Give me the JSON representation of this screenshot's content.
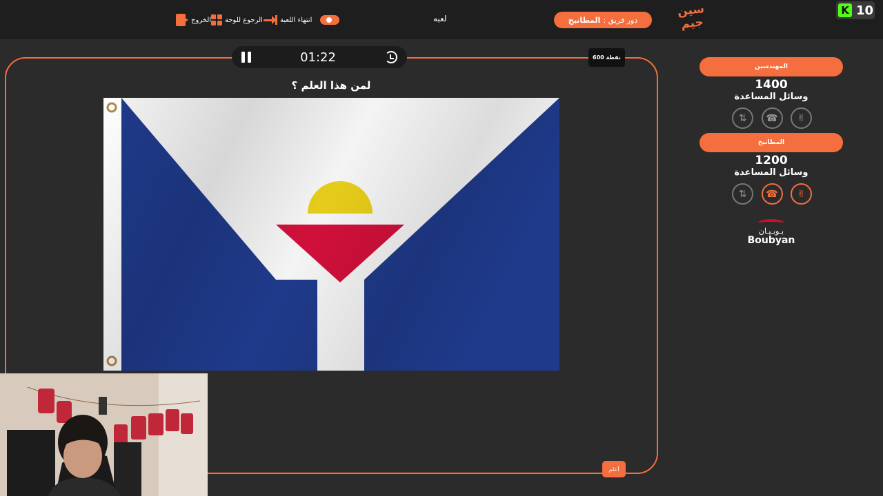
{
  "topbar": {
    "exit_label": "الخروج",
    "back_to_board_label": "الرجوع للوحة",
    "end_game_label": "انتهاء اللعبة",
    "game_label": "لعبه",
    "turn_prefix": "دور فريق :",
    "turn_team": "المطانيخ",
    "logo_text": "سين جيم",
    "kick_count": "10",
    "kick_letter": "K"
  },
  "board": {
    "timer": "01:22",
    "points": "600 نقطة",
    "question": "لمن هذا العلم ؟",
    "answer_button": "أعلم"
  },
  "teams": [
    {
      "name": "المهندسين",
      "score": "1400",
      "aids_label": "وسائل المساعدة",
      "aids": [
        "swap-icon",
        "phone-icon",
        "hand-icon"
      ],
      "active": [
        false,
        false,
        false
      ]
    },
    {
      "name": "المطانيخ",
      "score": "1200",
      "aids_label": "وسائل المساعدة",
      "aids": [
        "swap-icon",
        "phone-icon",
        "hand-icon"
      ],
      "active": [
        false,
        true,
        true
      ]
    }
  ],
  "sponsor": {
    "arabic": "بـوبـيـان",
    "english": "Boubyan"
  },
  "colors": {
    "accent": "#f46e3e",
    "background": "#2b2b2b",
    "topbar": "#1e1e1e",
    "flag_blue": "#1f3a8a",
    "flag_yellow": "#e6cc1a",
    "flag_red": "#d0103a"
  }
}
